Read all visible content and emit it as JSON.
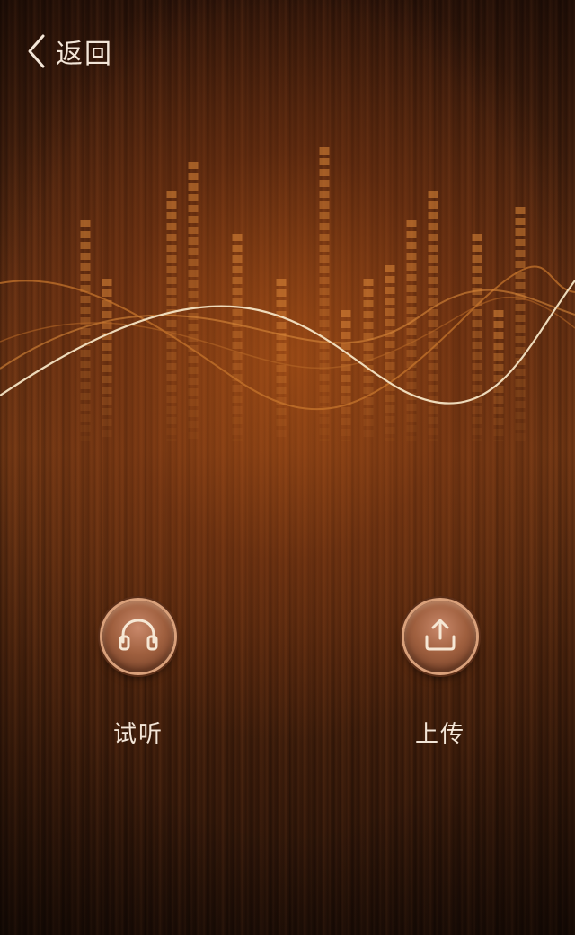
{
  "header": {
    "back_label": "返回",
    "back_icon": "chevron-left-icon"
  },
  "actions": [
    {
      "id": "listen",
      "label": "试听",
      "icon": "headphones-icon"
    },
    {
      "id": "upload",
      "label": "上传",
      "icon": "upload-icon"
    }
  ],
  "colors": {
    "text": "#f3e6d8",
    "accent_wave": "#f4e4c4",
    "wood_dark": "#2a1208",
    "wood_mid": "#6a3312"
  }
}
